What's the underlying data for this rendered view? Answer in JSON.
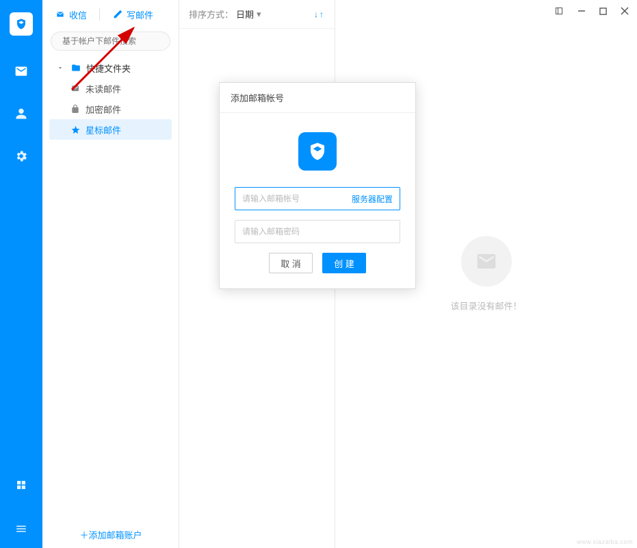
{
  "icon_sidebar": {
    "logo": "shield-mail"
  },
  "folder_panel": {
    "toolbar": {
      "receive_label": "收信",
      "compose_label": "写邮件"
    },
    "search_placeholder": "基于帐户下邮件搜索",
    "tree": {
      "root_label": "快捷文件夹",
      "items": [
        {
          "label": "未读邮件"
        },
        {
          "label": "加密邮件"
        },
        {
          "label": "星标邮件"
        }
      ]
    },
    "add_account_label": "＋添加邮箱账户"
  },
  "list_panel": {
    "sort_label": "排序方式：",
    "sort_value": "日期"
  },
  "preview_panel": {
    "empty_text": "该目录没有邮件！"
  },
  "dialog": {
    "title": "添加邮箱帐号",
    "account_placeholder": "请输入邮箱帐号",
    "server_link": "服务器配置",
    "password_placeholder": "请输入邮箱密码",
    "cancel_label": "取 消",
    "create_label": "创 建"
  },
  "watermark": "www.xiazaiba.com"
}
